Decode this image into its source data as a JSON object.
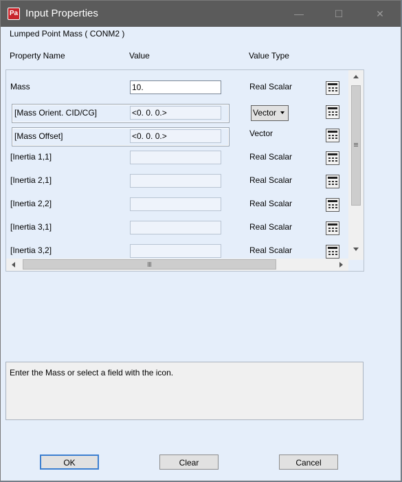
{
  "window": {
    "title": "Input Properties",
    "app_icon_text": "Pa"
  },
  "subtitle": "Lumped Point Mass ( CONM2 )",
  "headers": {
    "name": "Property Name",
    "value": "Value",
    "type": "Value Type"
  },
  "rows": [
    {
      "label": "Mass",
      "value": "10.",
      "type": "Real Scalar"
    },
    {
      "label": "[Mass Orient. CID/CG]",
      "value": "<0. 0. 0.>",
      "type": "Vector"
    },
    {
      "label": "[Mass Offset]",
      "value": "<0. 0. 0.>",
      "type": "Vector"
    },
    {
      "label": "[Inertia 1,1]",
      "value": "",
      "type": "Real Scalar"
    },
    {
      "label": "[Inertia 2,1]",
      "value": "",
      "type": "Real Scalar"
    },
    {
      "label": "[Inertia 2,2]",
      "value": "",
      "type": "Real Scalar"
    },
    {
      "label": "[Inertia 3,1]",
      "value": "",
      "type": "Real Scalar"
    },
    {
      "label": "[Inertia 3,2]",
      "value": "",
      "type": "Real Scalar"
    }
  ],
  "help_text": "Enter the Mass or select a field with the icon.",
  "buttons": {
    "ok": "OK",
    "clear": "Clear",
    "cancel": "Cancel"
  }
}
